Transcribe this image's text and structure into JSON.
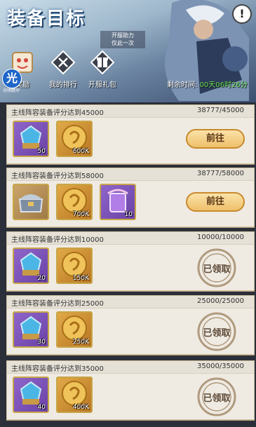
{
  "header": {
    "title": "装备目标",
    "info_icon": "!",
    "boost_badge": [
      "开服助力",
      "仅此一次"
    ],
    "countdown_label": "剩余时间:",
    "countdown_value": "00天06时26分"
  },
  "menu": [
    {
      "label": "奖励",
      "icon": "reward-icon"
    },
    {
      "label": "我的排行",
      "icon": "ranking-icon"
    },
    {
      "label": "开服礼包",
      "icon": "gift-icon"
    }
  ],
  "corner_badge": {
    "char": "光",
    "sub": "光明精华"
  },
  "tasks": [
    {
      "title": "主线阵容装备评分达到45000",
      "progress": "38777/45000",
      "status": "go",
      "button": "前往",
      "rewards": [
        {
          "type": "purple-chest",
          "qty": "50"
        },
        {
          "type": "gold-coin",
          "qty": "600K"
        }
      ]
    },
    {
      "title": "主线阵容装备评分达到58000",
      "progress": "38777/58000",
      "status": "go",
      "button": "前往",
      "rewards": [
        {
          "type": "gold-chest",
          "qty": ""
        },
        {
          "type": "gold-coin",
          "qty": "700K"
        },
        {
          "type": "purple-scroll",
          "qty": "10"
        }
      ]
    },
    {
      "title": "主线阵容装备评分达到10000",
      "progress": "10000/10000",
      "status": "claimed",
      "button": "已领取",
      "rewards": [
        {
          "type": "purple-chest",
          "qty": "20"
        },
        {
          "type": "gold-coin",
          "qty": "150K"
        }
      ]
    },
    {
      "title": "主线阵容装备评分达到25000",
      "progress": "25000/25000",
      "status": "claimed",
      "button": "已领取",
      "rewards": [
        {
          "type": "purple-chest",
          "qty": "30"
        },
        {
          "type": "gold-coin",
          "qty": "250K"
        }
      ]
    },
    {
      "title": "主线阵容装备评分达到35000",
      "progress": "35000/35000",
      "status": "claimed",
      "button": "已领取",
      "rewards": [
        {
          "type": "purple-chest",
          "qty": "40"
        },
        {
          "type": "gold-coin",
          "qty": "400K"
        }
      ]
    }
  ],
  "colors": {
    "accent_green": "#6de35a",
    "card_bg": "#efebe3",
    "button_gold": "#eec06b"
  }
}
